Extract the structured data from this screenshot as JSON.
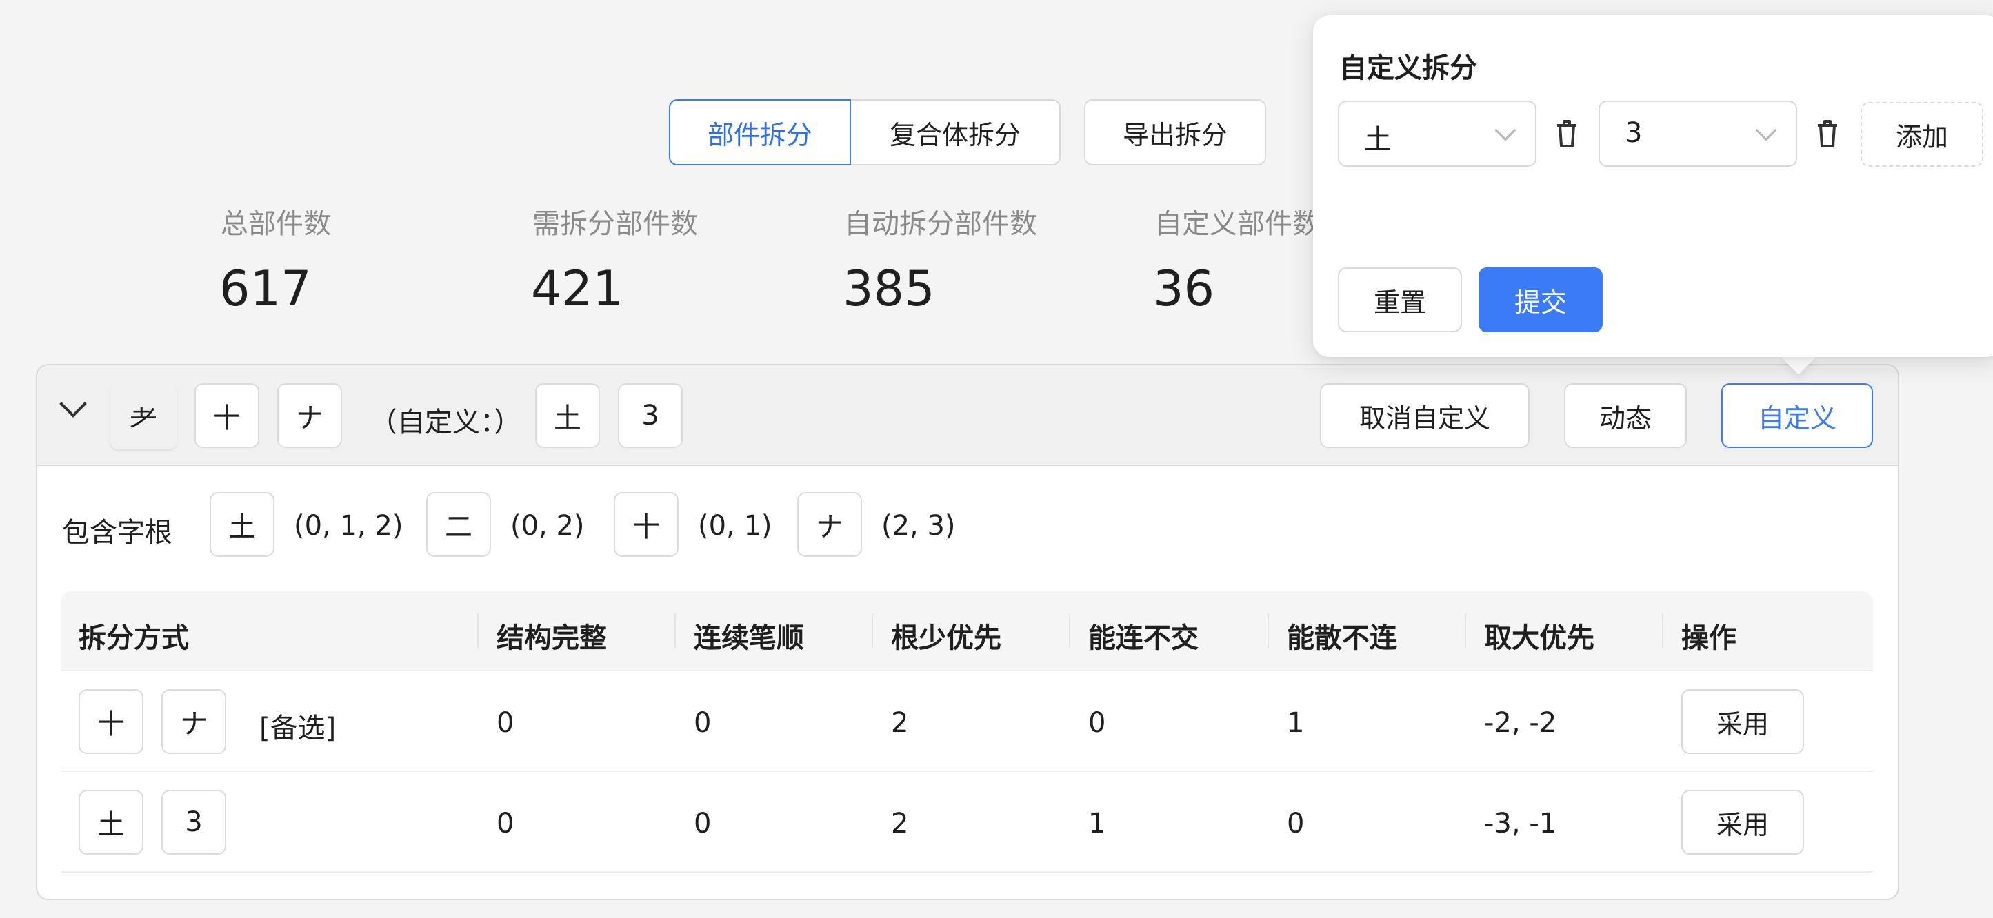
{
  "tabs": {
    "component_split": "部件拆分",
    "compound_split": "复合体拆分"
  },
  "export_button": "导出拆分",
  "stats": [
    {
      "label": "总部件数",
      "value": "617"
    },
    {
      "label": "需拆分部件数",
      "value": "421"
    },
    {
      "label": "自动拆分部件数",
      "value": "385"
    },
    {
      "label": "自定义部件数",
      "value": "36"
    }
  ],
  "card": {
    "component": "耂",
    "parts": [
      "十",
      "ナ"
    ],
    "custom_label": "（自定义：）",
    "custom_parts": [
      "土",
      "3"
    ],
    "actions": {
      "cancel_custom": "取消自定义",
      "dynamic": "动态",
      "custom": "自定义"
    },
    "roots_label": "包含字根",
    "roots": [
      {
        "glyph": "土",
        "index": "(0, 1, 2)"
      },
      {
        "glyph": "二",
        "index": "(0, 2)"
      },
      {
        "glyph": "十",
        "index": "(0, 1)"
      },
      {
        "glyph": "ナ",
        "index": "(2, 3)"
      }
    ]
  },
  "table": {
    "headers": [
      "拆分方式",
      "结构完整",
      "连续笔顺",
      "根少优先",
      "能连不交",
      "能散不连",
      "取大优先",
      "操作"
    ],
    "rows": [
      {
        "parts": [
          "十",
          "ナ"
        ],
        "tag": "[备选]",
        "values": [
          "0",
          "0",
          "2",
          "0",
          "1",
          "-2, -2"
        ],
        "action": "采用"
      },
      {
        "parts": [
          "土",
          "3"
        ],
        "tag": "",
        "values": [
          "0",
          "0",
          "2",
          "1",
          "0",
          "-3, -1"
        ],
        "action": "采用"
      }
    ]
  },
  "popover": {
    "title": "自定义拆分",
    "selects": [
      "土",
      "3"
    ],
    "add": "添加",
    "reset": "重置",
    "submit": "提交"
  },
  "colors": {
    "accent": "#3b7bf6",
    "background": "#f4f4f5"
  }
}
